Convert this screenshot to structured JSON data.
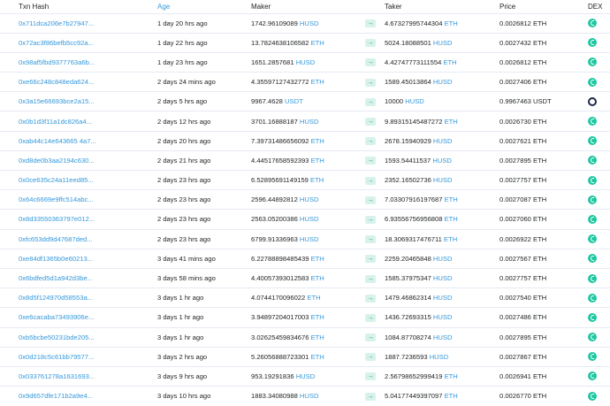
{
  "headers": {
    "hash": "Txn Hash",
    "age": "Age",
    "maker": "Maker",
    "taker": "Taker",
    "price": "Price",
    "dex": "DEX"
  },
  "rows": [
    {
      "hash": "0x711dca206e7b27947...",
      "age": "1 day 20 hrs ago",
      "maker_amt": "1742.96109089",
      "maker_tok": "HUSD",
      "taker_amt": "4.67327995744304",
      "taker_tok": "ETH",
      "price": "0.0026812 ETH",
      "dex": "dodo"
    },
    {
      "hash": "0x72ac3f86befb5cc92a...",
      "age": "1 day 22 hrs ago",
      "maker_amt": "13.7824638106582",
      "maker_tok": "ETH",
      "taker_amt": "5024.18088501",
      "taker_tok": "HUSD",
      "price": "0.0027432 ETH",
      "dex": "dodo"
    },
    {
      "hash": "0x98af5fbd9377763a6b...",
      "age": "1 day 23 hrs ago",
      "maker_amt": "1651.2857681",
      "maker_tok": "HUSD",
      "taker_amt": "4.42747773111554",
      "taker_tok": "ETH",
      "price": "0.0026812 ETH",
      "dex": "dodo"
    },
    {
      "hash": "0xe66c248c848eda624...",
      "age": "2 days 24 mins ago",
      "maker_amt": "4.35597127432772",
      "maker_tok": "ETH",
      "taker_amt": "1589.45013864",
      "taker_tok": "HUSD",
      "price": "0.0027406 ETH",
      "dex": "dodo"
    },
    {
      "hash": "0x3a15e66693bce2a15...",
      "age": "2 days 5 hrs ago",
      "maker_amt": "9967.4628",
      "maker_tok": "USDT",
      "taker_amt": "10000",
      "taker_tok": "HUSD",
      "price": "0.9967463 USDT",
      "dex": "ring"
    },
    {
      "hash": "0x0b1d3f11a1dc826a4...",
      "age": "2 days 12 hrs ago",
      "maker_amt": "3701.16888187",
      "maker_tok": "HUSD",
      "taker_amt": "9.89315145487272",
      "taker_tok": "ETH",
      "price": "0.0026730 ETH",
      "dex": "dodo"
    },
    {
      "hash": "0xab44c14e643665 4a7...",
      "age": "2 days 20 hrs ago",
      "maker_amt": "7.39731486656092",
      "maker_tok": "ETH",
      "taker_amt": "2678.15940929",
      "taker_tok": "HUSD",
      "price": "0.0027621 ETH",
      "dex": "dodo"
    },
    {
      "hash": "0xd8de0b3aa2194c630...",
      "age": "2 days 21 hrs ago",
      "maker_amt": "4.44517658592393",
      "maker_tok": "ETH",
      "taker_amt": "1593.54411537",
      "taker_tok": "HUSD",
      "price": "0.0027895 ETH",
      "dex": "dodo"
    },
    {
      "hash": "0x0ce635c24a11eed85...",
      "age": "2 days 23 hrs ago",
      "maker_amt": "6.52895691149159",
      "maker_tok": "ETH",
      "taker_amt": "2352.16502736",
      "taker_tok": "HUSD",
      "price": "0.0027757 ETH",
      "dex": "dodo"
    },
    {
      "hash": "0x64c6669e9ffc514abc...",
      "age": "2 days 23 hrs ago",
      "maker_amt": "2596.44892812",
      "maker_tok": "HUSD",
      "taker_amt": "7.03307916197687",
      "taker_tok": "ETH",
      "price": "0.0027087 ETH",
      "dex": "dodo"
    },
    {
      "hash": "0x8d33550363797e012...",
      "age": "2 days 23 hrs ago",
      "maker_amt": "2563.05200386",
      "maker_tok": "HUSD",
      "taker_amt": "6.93556756956808",
      "taker_tok": "ETH",
      "price": "0.0027060 ETH",
      "dex": "dodo"
    },
    {
      "hash": "0xfc653dd9d47687ded...",
      "age": "2 days 23 hrs ago",
      "maker_amt": "6799.91336963",
      "maker_tok": "HUSD",
      "taker_amt": "18.3069317476711",
      "taker_tok": "ETH",
      "price": "0.0026922 ETH",
      "dex": "dodo"
    },
    {
      "hash": "0xe84df1365b0e60213...",
      "age": "3 days 41 mins ago",
      "maker_amt": "6.22788898485439",
      "maker_tok": "ETH",
      "taker_amt": "2259.20465848",
      "taker_tok": "HUSD",
      "price": "0.0027567 ETH",
      "dex": "dodo"
    },
    {
      "hash": "0x6bdfed5d1a942d3be...",
      "age": "3 days 58 mins ago",
      "maker_amt": "4.40057393012583",
      "maker_tok": "ETH",
      "taker_amt": "1585.37975347",
      "taker_tok": "HUSD",
      "price": "0.0027757 ETH",
      "dex": "dodo"
    },
    {
      "hash": "0x8d5f124970d58553a...",
      "age": "3 days 1 hr ago",
      "maker_amt": "4.0744170096022",
      "maker_tok": "ETH",
      "taker_amt": "1479.46862314",
      "taker_tok": "HUSD",
      "price": "0.0027540 ETH",
      "dex": "dodo"
    },
    {
      "hash": "0xe6cacaba73493906e...",
      "age": "3 days 1 hr ago",
      "maker_amt": "3.94897204017003",
      "maker_tok": "ETH",
      "taker_amt": "1436.72693315",
      "taker_tok": "HUSD",
      "price": "0.0027486 ETH",
      "dex": "dodo"
    },
    {
      "hash": "0xb5bcbe50231bde205...",
      "age": "3 days 1 hr ago",
      "maker_amt": "3.02625459834676",
      "maker_tok": "ETH",
      "taker_amt": "1084.87708274",
      "taker_tok": "HUSD",
      "price": "0.0027895 ETH",
      "dex": "dodo"
    },
    {
      "hash": "0x0d218c5c61bb79577...",
      "age": "3 days 2 hrs ago",
      "maker_amt": "5.26056888723301",
      "maker_tok": "ETH",
      "taker_amt": "1887.7236593",
      "taker_tok": "HUSD",
      "price": "0.0027867 ETH",
      "dex": "dodo"
    },
    {
      "hash": "0x033761278a1631693...",
      "age": "3 days 9 hrs ago",
      "maker_amt": "953.19291836",
      "maker_tok": "HUSD",
      "taker_amt": "2.56798652999419",
      "taker_tok": "ETH",
      "price": "0.0026941 ETH",
      "dex": "dodo"
    },
    {
      "hash": "0x9d657dfe171b2a9e4...",
      "age": "3 days 10 hrs ago",
      "maker_amt": "1883.34080988",
      "maker_tok": "HUSD",
      "taker_amt": "5.04177449397097",
      "taker_tok": "ETH",
      "price": "0.0026770 ETH",
      "dex": "dodo"
    }
  ],
  "icons": {
    "arrow": "right-arrow-icon",
    "dex_dodo": "dodo-logo-icon",
    "dex_ring": "ring-logo-icon"
  },
  "colors": {
    "link": "#3498db",
    "arrow_bg": "#d7f2ea",
    "arrow_fg": "#00a186",
    "dodo": "#1fc7a0"
  }
}
